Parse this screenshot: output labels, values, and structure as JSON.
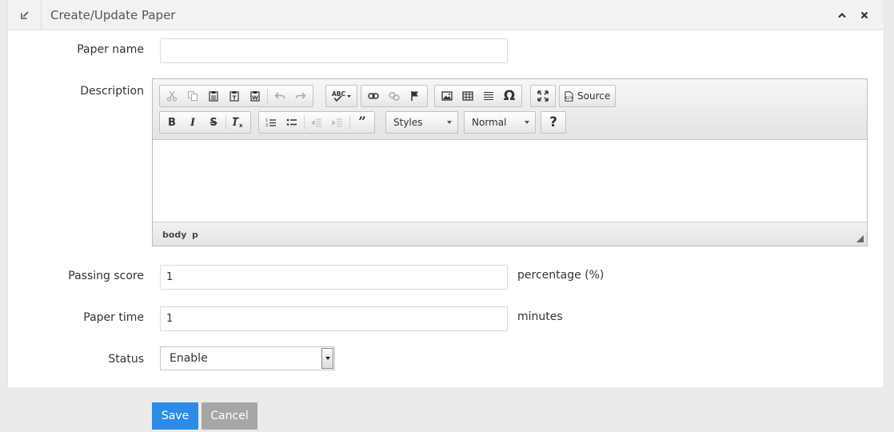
{
  "header": {
    "title": "Create/Update Paper",
    "icon": "edit-icon",
    "collapse_icon": "chevron-up-icon",
    "close_icon": "close-icon"
  },
  "form": {
    "paper_name": {
      "label": "Paper name",
      "value": ""
    },
    "description": {
      "label": "Description"
    },
    "passing_score": {
      "label": "Passing score",
      "value": "1",
      "suffix": "percentage (%)"
    },
    "paper_time": {
      "label": "Paper time",
      "value": "1",
      "suffix": "minutes"
    },
    "status": {
      "label": "Status",
      "selected": "Enable"
    }
  },
  "editor": {
    "source_label": "Source",
    "styles_label": "Styles",
    "format_label": "Normal",
    "help_label": "?",
    "path": [
      "body",
      "p"
    ]
  },
  "buttons": {
    "save": "Save",
    "cancel": "Cancel"
  },
  "colors": {
    "save_bg": "#2d8ae6",
    "cancel_bg": "#a6a6a6",
    "header_bg": "#f2f2f2"
  }
}
